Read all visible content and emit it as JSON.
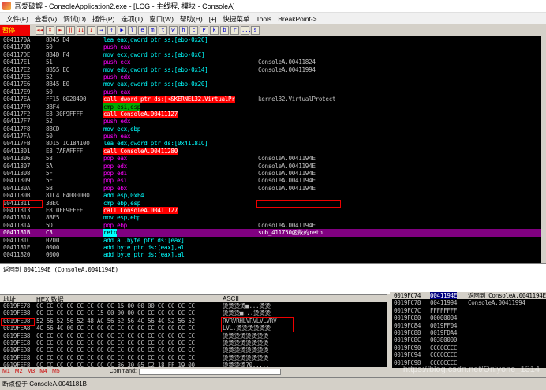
{
  "title": "吾爱破解 - ConsoleApplication2.exe - [LCG - 主线程, 模块 - ConsoleA]",
  "menu": [
    "文件(F)",
    "查看(V)",
    "调试(D)",
    "插件(P)",
    "选项(T)",
    "窗口(W)",
    "帮助(H)",
    "[+]",
    "快捷菜单",
    "Tools",
    "BreakPoint->"
  ],
  "toolbar": {
    "pause": "暂停",
    "buttons": [
      "◄◄",
      "×",
      "►",
      "‖",
      "↓↓",
      "↓",
      "→",
      "↑",
      "▶",
      "l",
      "e",
      "m",
      "t",
      "w",
      "h",
      "c",
      "P",
      "k",
      "b",
      "r",
      "...",
      "s"
    ]
  },
  "disasm": [
    {
      "a": "0041170A",
      "h": "8D45 D4",
      "d": "lea eax,dword ptr ss:[ebp-0x2C]",
      "c": "",
      "k": ""
    },
    {
      "a": "0041170D",
      "h": "50",
      "d": "push eax",
      "c": "",
      "k": "push"
    },
    {
      "a": "004117DE",
      "h": "8B4D F4",
      "d": "mov ecx,dword ptr ss:[ebp-0xC]",
      "c": "",
      "k": ""
    },
    {
      "a": "004117E1",
      "h": "51",
      "d": "push ecx",
      "c": "ConsoleA.00411824",
      "k": "push"
    },
    {
      "a": "004117E2",
      "h": "8B55 EC",
      "d": "mov edx,dword ptr ss:[ebp-0x14]",
      "c": "ConsoleA.00411994",
      "k": ""
    },
    {
      "a": "004117E5",
      "h": "52",
      "d": "push edx",
      "c": "",
      "k": "push"
    },
    {
      "a": "004117E6",
      "h": "8B45 E0",
      "d": "mov eax,dword ptr ss:[ebp-0x20]",
      "c": "",
      "k": ""
    },
    {
      "a": "004117E9",
      "h": "50",
      "d": "push eax",
      "c": "",
      "k": "push"
    },
    {
      "a": "004117EA",
      "h": "FF15 0020400",
      "d": "call dword ptr ds:[<&KERNEL32.VirtualPr",
      "c": "kernel32.VirtualProtect",
      "k": "call"
    },
    {
      "a": "004117F0",
      "h": "3BF4",
      "d": "cmp esi,esp",
      "c": "",
      "k": "reg"
    },
    {
      "a": "004117F2",
      "h": "E8 30F9FFFF",
      "d": "call ConsoleA.00411127",
      "c": "",
      "k": "call"
    },
    {
      "a": "004117F7",
      "h": "52",
      "d": "push edx",
      "c": "",
      "k": "push"
    },
    {
      "a": "004117F8",
      "h": "8BCD",
      "d": "mov ecx,ebp",
      "c": "",
      "k": ""
    },
    {
      "a": "004117FA",
      "h": "50",
      "d": "push eax",
      "c": "",
      "k": "push"
    },
    {
      "a": "004117FB",
      "h": "8D15 1C184100",
      "d": "lea edx,dword ptr ds:[0x41181C]",
      "c": "",
      "k": ""
    },
    {
      "a": "00411801",
      "h": "E8 7AFAFFFF",
      "d": "call ConsoleA.00411280",
      "c": "",
      "k": "call"
    },
    {
      "a": "00411806",
      "h": "58",
      "d": "pop eax",
      "c": "ConsoleA.0041194E",
      "k": "pop"
    },
    {
      "a": "00411807",
      "h": "5A",
      "d": "pop edx",
      "c": "ConsoleA.0041194E",
      "k": "pop"
    },
    {
      "a": "00411808",
      "h": "5F",
      "d": "pop edi",
      "c": "ConsoleA.0041194E",
      "k": "pop"
    },
    {
      "a": "00411809",
      "h": "5E",
      "d": "pop esi",
      "c": "ConsoleA.0041194E",
      "k": "pop"
    },
    {
      "a": "0041180A",
      "h": "5B",
      "d": "pop ebx",
      "c": "ConsoleA.0041194E",
      "k": "pop"
    },
    {
      "a": "0041180B",
      "h": "81C4 F4000000",
      "d": "add esp,0xF4",
      "c": "",
      "k": ""
    },
    {
      "a": "00411811",
      "h": "3BEC",
      "d": "cmp ebp,esp",
      "c": "",
      "k": ""
    },
    {
      "a": "00411813",
      "h": "E8 0FF9FFFF",
      "d": "call ConsoleA.00411127",
      "c": "",
      "k": "call"
    },
    {
      "a": "00411818",
      "h": "8BE5",
      "d": "mov esp,ebp",
      "c": "",
      "k": ""
    },
    {
      "a": "0041181A",
      "h": "5D",
      "d": "pop ebp",
      "c": "ConsoleA.0041194E",
      "k": "pop"
    },
    {
      "a": "0041181B",
      "h": "C3",
      "d": "retn",
      "c": "sub_411750函数的retn",
      "k": "ret",
      "sel": true
    },
    {
      "a": "0041181C",
      "h": "0200",
      "d": "add al,byte ptr ds:[eax]",
      "c": "",
      "k": ""
    },
    {
      "a": "0041181E",
      "h": "0000",
      "d": "add byte ptr ds:[eax],al",
      "c": "",
      "k": ""
    },
    {
      "a": "00411820",
      "h": "0000",
      "d": "add byte ptr ds:[eax],al",
      "c": "",
      "k": ""
    }
  ],
  "info": {
    "line1": "返回到 0041194E (ConsoleA.0041194E)"
  },
  "dump_header": {
    "addr": "地址",
    "hex": "HEX 数据",
    "ascii": "ASCII"
  },
  "dump": [
    {
      "a": "0019FE78",
      "h": "CC CC CC CC CC CC CC CC 15 00 00 00 CC CC CC CC",
      "s": "烫烫烫烫■...烫烫"
    },
    {
      "a": "0019FE88",
      "h": "CC CC CC CC CC CC 15 00 00 00 CC CC CC CC CC CC",
      "s": "烫烫烫■...烫烫烫"
    },
    {
      "a": "0019FE98",
      "h": "52 56 52 56 52 48 AC 56 52 56 4C 56 4C 52 56 52",
      "s": "RVRVRHLVRVLVLVRV"
    },
    {
      "a": "0019FEA8",
      "h": "4C 56 4C 00 CC CC CC CC CC CC CC CC CC CC CC CC",
      "s": "LVL.烫烫烫烫烫烫"
    },
    {
      "a": "0019FEB8",
      "h": "CC CC CC CC CC CC CC CC CC CC CC CC CC CC CC CC",
      "s": "烫烫烫烫烫烫烫烫"
    },
    {
      "a": "0019FEC8",
      "h": "CC CC CC CC CC CC CC CC CC CC CC CC CC CC CC CC",
      "s": "烫烫烫烫烫烫烫烫"
    },
    {
      "a": "0019FED8",
      "h": "CC CC CC CC CC CC CC CC CC CC CC CC CC CC CC CC",
      "s": "烫烫烫烫烫烫烫烫"
    },
    {
      "a": "0019FEE8",
      "h": "CC CC CC CC CC CC CC CC CC CC CC CC CC CC CC CC",
      "s": "烫烫烫烫烫烫烫烫"
    },
    {
      "a": "0019FEF8",
      "h": "CC CC CC CC CC CC CC CC 86 30 05 C2 18 FF 19 00",
      "s": "烫烫烫烫?0....."
    }
  ],
  "stack": [
    {
      "a": "0019FC74",
      "v": "0041194E",
      "c": "返回到 ConsoleA.0041194E",
      "top": true
    },
    {
      "a": "0019FC78",
      "v": "00411994",
      "c": "ConsoleA.00411994"
    },
    {
      "a": "0019FC7C",
      "v": "FFFFFFFF",
      "c": ""
    },
    {
      "a": "0019FC80",
      "v": "00000004",
      "c": ""
    },
    {
      "a": "0019FC84",
      "v": "0019FF04",
      "c": ""
    },
    {
      "a": "0019FC88",
      "v": "0019FDA4",
      "c": ""
    },
    {
      "a": "0019FC8C",
      "v": "00380000",
      "c": ""
    },
    {
      "a": "0019FC90",
      "v": "CCCCCCCC",
      "c": ""
    },
    {
      "a": "0019FC94",
      "v": "CCCCCCCC",
      "c": ""
    },
    {
      "a": "0019FC98",
      "v": "CCCCCCCC",
      "c": ""
    }
  ],
  "tabs": [
    "M1",
    "M2",
    "M3",
    "M4",
    "M5"
  ],
  "command_label": "Command:",
  "status": "断点位于 ConsoleA.0041181B",
  "watermark": "https://blog.csdn.net/Onlyone_1314"
}
